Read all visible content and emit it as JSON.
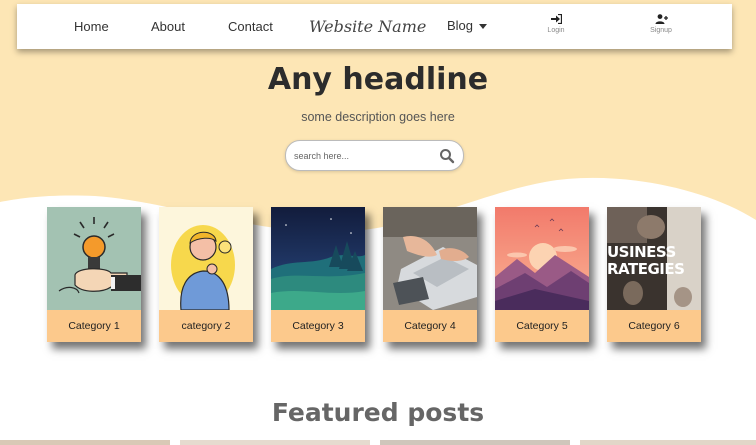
{
  "nav": {
    "links": [
      "Home",
      "About",
      "Contact"
    ],
    "brand": "Website Name",
    "blog": "Blog",
    "login": "Login",
    "signup": "Signup"
  },
  "hero": {
    "headline": "Any headline",
    "description": "some description goes here"
  },
  "search": {
    "placeholder": "search here..."
  },
  "categories": [
    {
      "label": "Category 1",
      "image": "lightbulb-hand-illustration"
    },
    {
      "label": "category 2",
      "image": "thinking-man-illustration"
    },
    {
      "label": "Category 3",
      "image": "night-forest-landscape"
    },
    {
      "label": "Category 4",
      "image": "laptop-typing-photo"
    },
    {
      "label": "Category 5",
      "image": "sunset-mountains-illustration"
    },
    {
      "label": "Category 6",
      "image": "business-strategies-photo",
      "text": "USINESS\nRATEGIES"
    }
  ],
  "featured": {
    "title": "Featured posts"
  },
  "colors": {
    "background_wave": "#fde6b5",
    "card_label": "#fcc98c",
    "headline": "#2c2c2c"
  }
}
